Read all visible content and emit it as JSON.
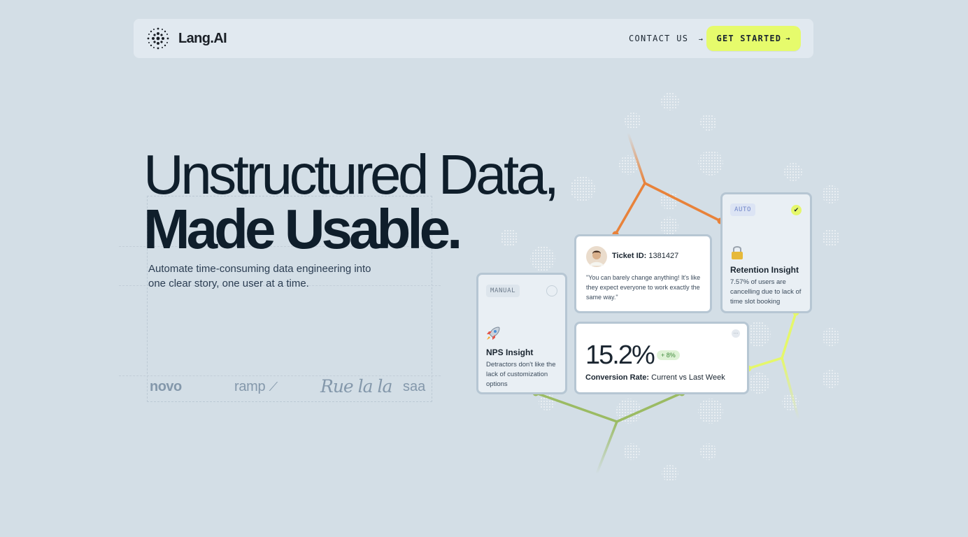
{
  "nav": {
    "logo_text": "Lang.AI",
    "contact_label": "CONTACT US",
    "cta_label": "GET STARTED",
    "arrow": "→"
  },
  "hero": {
    "line1": "Unstructured Data,",
    "line2": "Made Usable.",
    "subtitle": "Automate time-consuming data engineering into one clear story, one user at a time."
  },
  "brands": [
    "novo",
    "ramp",
    "Rue la la",
    "saa"
  ],
  "cards": {
    "manual": {
      "tag": "MANUAL",
      "icon": "rocket-icon",
      "title": "NPS Insight",
      "text": "Detractors don't like the lack of customization options"
    },
    "ticket": {
      "id_label": "Ticket ID:",
      "id_value": "1381427",
      "quote": "\"You can barely change anything! It's like they expect everyone to work exactly the same way.\""
    },
    "auto": {
      "tag": "AUTO",
      "icon": "lock-icon",
      "title": "Retention Insight",
      "text": "7.57% of users are cancelling due to lack of time slot booking"
    },
    "conversion": {
      "value": "15.2%",
      "delta": "+ 8%",
      "label_bold": "Conversion Rate:",
      "label_rest": "Current vs Last Week"
    }
  },
  "colors": {
    "background": "#d3dee6",
    "accent": "#e6fb6c",
    "orange": "#e8823a",
    "green": "#9bbb63",
    "lime": "#e5f76a",
    "card_border": "#b6c6d3"
  }
}
